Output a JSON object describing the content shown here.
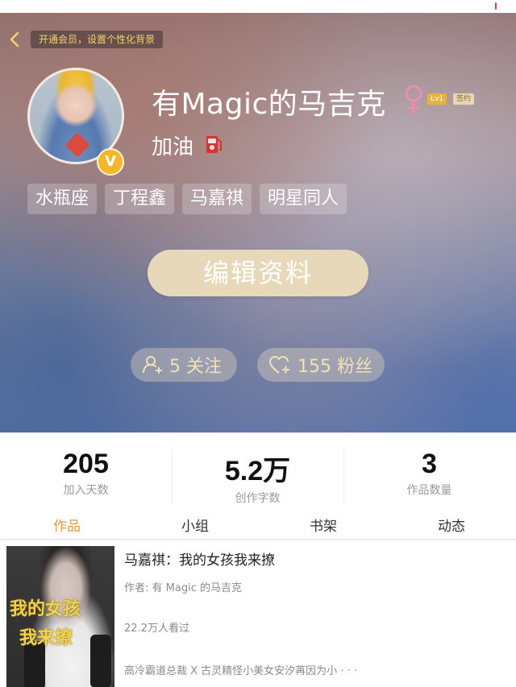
{
  "header": {
    "vip_banner": "开通会员，设置个性化背景",
    "username": "有Magic的马吉克",
    "level_badge": "Lv1",
    "sign_badge": "签约",
    "motto": "加油",
    "avatar_badge": "V",
    "tags": [
      "水瓶座",
      "丁程鑫",
      "马嘉祺",
      "明星同人"
    ],
    "edit_button": "编辑资料",
    "following": "5 关注",
    "fans": "155 粉丝"
  },
  "stats": [
    {
      "value": "205",
      "label": "加入天数"
    },
    {
      "value": "5.2万",
      "label": "创作字数"
    },
    {
      "value": "3",
      "label": "作品数量"
    }
  ],
  "tabs": [
    {
      "label": "作品",
      "active": true
    },
    {
      "label": "小组",
      "active": false
    },
    {
      "label": "书架",
      "active": false
    },
    {
      "label": "动态",
      "active": false
    }
  ],
  "book": {
    "cover_text_line1": "我的女孩",
    "cover_text_line2": "我来撩",
    "title": "马嘉祺：我的女孩我来撩",
    "author": "作者: 有 Magic 的马吉克",
    "views": "22.2万人看过",
    "description": "高冷霸道总裁 X 古灵精怪小美女安汐苒因为小 · · ·"
  },
  "colors": {
    "accent": "#e69b3a",
    "vip_text": "#f3d36a",
    "edit_button_bg": "#e6d8b8",
    "pill_text": "#f1e2b4"
  }
}
